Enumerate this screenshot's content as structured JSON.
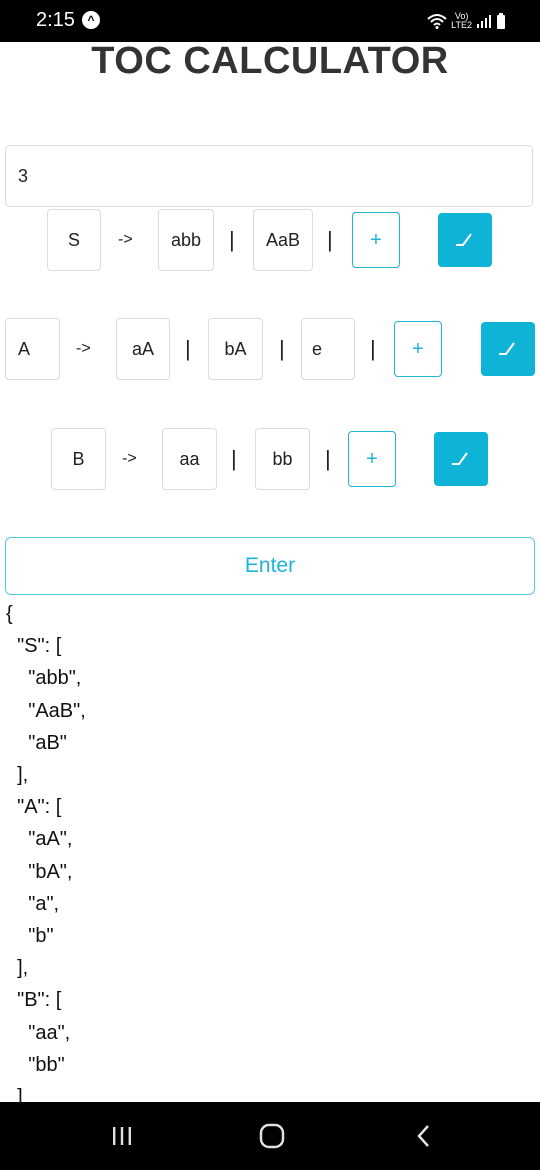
{
  "status_bar": {
    "time": "2:15",
    "badge": "^",
    "network": [
      "Vo)",
      "LTE2"
    ]
  },
  "title": "TOC CALCULATOR",
  "count_input": {
    "value": "3"
  },
  "rules": [
    {
      "variable": "S",
      "arrow": "->",
      "productions": [
        "abb",
        "AaB"
      ],
      "pipe": "|",
      "add_label": "+"
    },
    {
      "variable": "A",
      "arrow": "->",
      "productions": [
        "aA",
        "bA",
        "e"
      ],
      "pipe": "|",
      "add_label": "+"
    },
    {
      "variable": "B",
      "arrow": "->",
      "productions": [
        "aa",
        "bb"
      ],
      "pipe": "|",
      "add_label": "+"
    }
  ],
  "enter_label": "Enter",
  "output_lines": [
    "{",
    "  \"S\": [",
    "    \"abb\",",
    "    \"AaB\",",
    "    \"aB\"",
    "  ],",
    "  \"A\": [",
    "    \"aA\",",
    "    \"bA\",",
    "    \"a\",",
    "    \"b\"",
    "  ],",
    "  \"B\": [",
    "    \"aa\",",
    "    \"bb\"",
    "  ]"
  ],
  "colors": {
    "accent": "#0fb3d6",
    "accent_text": "#1db4d8",
    "status_bar": "#000000"
  },
  "icons": {
    "confirm": "check-icon",
    "nav_recent": "recent-apps-icon",
    "nav_home": "home-icon",
    "nav_back": "back-icon"
  }
}
